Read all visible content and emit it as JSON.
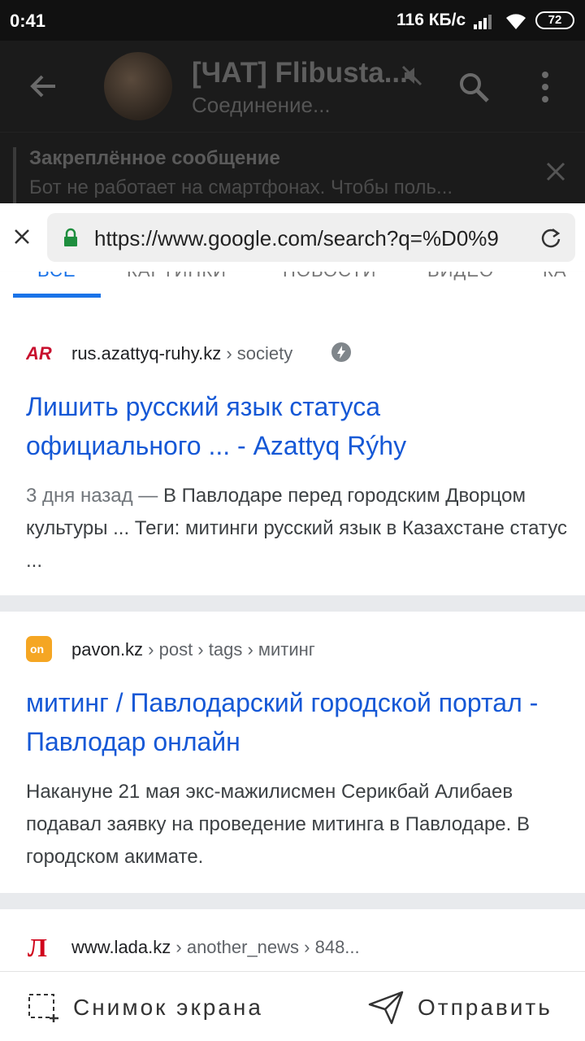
{
  "statusbar": {
    "time": "0:41",
    "speed": "116 КБ/с",
    "battery": "72"
  },
  "chat": {
    "title": "[ЧАТ] Flibusta...",
    "subtitle": "Соединение..."
  },
  "pinned": {
    "title": "Закреплённое сообщение",
    "text": "Бот не работает на смартфонах. Чтобы поль..."
  },
  "browser": {
    "url": "https://www.google.com/search?q=%D0%9"
  },
  "tabs": [
    "ВСЕ",
    "КАРТИНКИ",
    "НОВОСТИ",
    "ВИДЕО",
    "КА"
  ],
  "results": [
    {
      "domain": "rus.azattyq-ruhy.kz",
      "path": " › society",
      "title": "Лишить русский язык статуса официального ... - Azattyq Rýhy",
      "date": "3 дня назад — ",
      "snippet": "В Павлодаре перед городским Дворцом культуры ... Теги: митинги русский язык в Казахстане статус ...",
      "favicon_color": "#c8102e"
    },
    {
      "domain": "pavon.kz",
      "path": " › post › tags › митинг",
      "title": "митинг / Павлодарский городской портал - Павлодар онлайн",
      "snippet": "Накануне 21 мая экс-мажилисмен Серикбай Алибаев подавал заявку на проведение митинга в Павлодаре. В городском акимате.",
      "favicon_color": "#f5a623"
    },
    {
      "domain": "www.lada.kz",
      "path": " › another_news › 848...",
      "favicon_color": "#d0021b"
    }
  ],
  "bottombar": {
    "screenshot_label": "Снимок экрана",
    "send_label": "Отправить"
  },
  "colors": {
    "link": "#1558d6",
    "chat_bg": "#1b1b1b",
    "statusbar_bg": "#111111"
  }
}
